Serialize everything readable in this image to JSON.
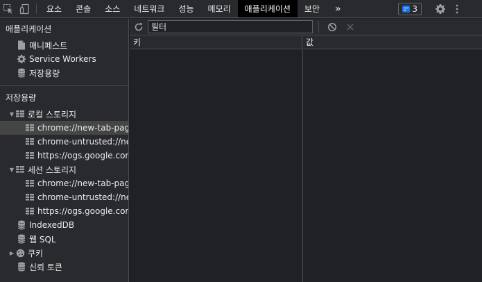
{
  "toolbar_tabs": [
    {
      "label": "요소",
      "active": false
    },
    {
      "label": "콘솔",
      "active": false
    },
    {
      "label": "소스",
      "active": false
    },
    {
      "label": "네트워크",
      "active": false
    },
    {
      "label": "성능",
      "active": false
    },
    {
      "label": "메모리",
      "active": false
    },
    {
      "label": "애플리케이션",
      "active": true
    },
    {
      "label": "보안",
      "active": false
    }
  ],
  "more_tabs": "»",
  "issues_count": "3",
  "icons": {
    "inspect": "inspect-element-icon",
    "device": "device-toolbar-icon",
    "issues": "issues-message-icon",
    "settings": "gear-icon",
    "menu": "kebab-menu-icon",
    "refresh": "refresh-icon",
    "clear": "clear-all-icon",
    "delete": "delete-selected-icon"
  },
  "sidebar": {
    "application_title": "애플리케이션",
    "application_items": [
      {
        "label": "매니페스트",
        "icon": "document-icon"
      },
      {
        "label": "Service Workers",
        "icon": "gear-icon"
      },
      {
        "label": "저장용량",
        "icon": "database-icon"
      }
    ],
    "storage_title": "저장용량",
    "local_storage": {
      "label": "로컬 스토리지",
      "items": [
        "chrome://new-tab-page",
        "chrome-untrusted://new",
        "https://ogs.google.com"
      ]
    },
    "session_storage": {
      "label": "세션 스토리지",
      "items": [
        "chrome://new-tab-page",
        "chrome-untrusted://new",
        "https://ogs.google.com"
      ]
    },
    "indexeddb": "IndexedDB",
    "websql": "웹 SQL",
    "cookies": "쿠키",
    "trust_tokens": "신뢰 토큰"
  },
  "main": {
    "filter_placeholder": "필터",
    "col_key": "키",
    "col_value": "값"
  },
  "colors": {
    "background": "#202124",
    "panel": "#292a2d",
    "active_tab": "#000000",
    "selected_item": "#454545",
    "badge_blue": "#1a73e8"
  }
}
